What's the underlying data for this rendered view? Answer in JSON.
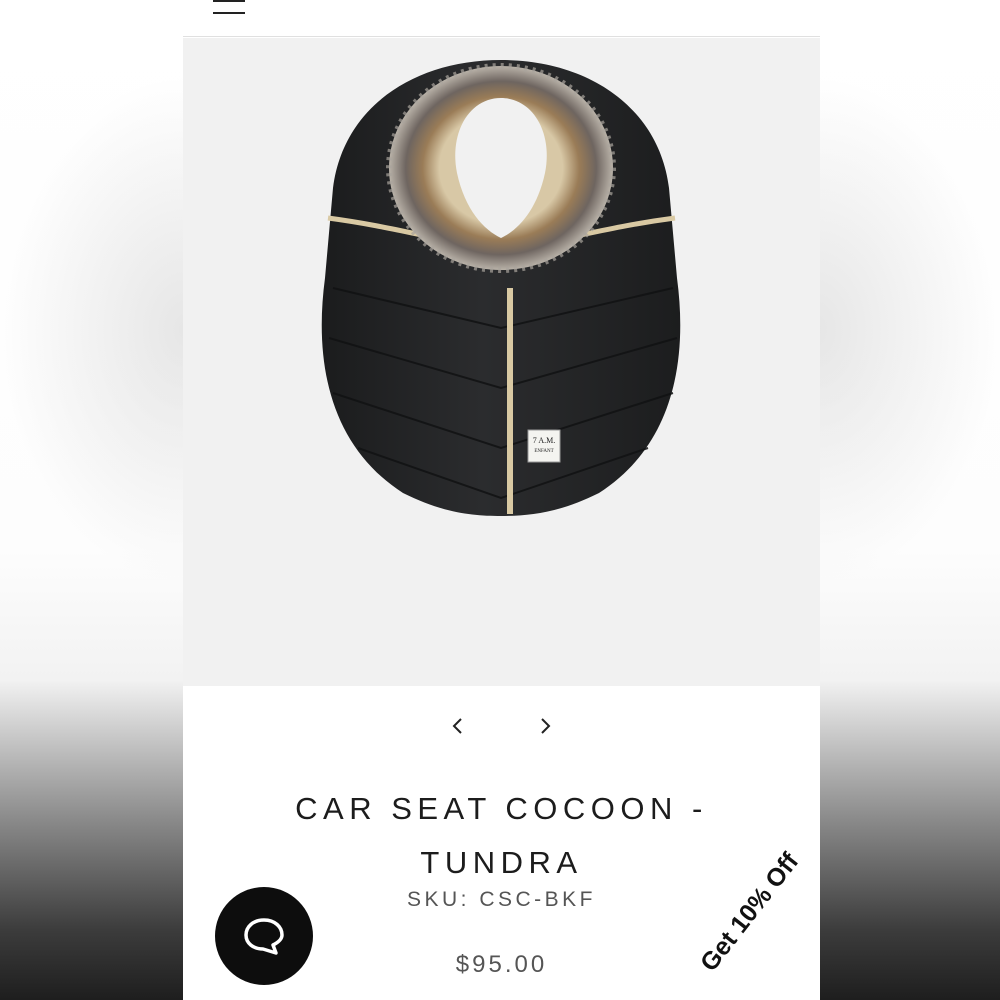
{
  "product": {
    "title": "CAR SEAT COCOON - TUNDRA",
    "sku": "SKU: CSC-BKF",
    "price": "$95.00",
    "image_label": {
      "line1": "7 A.M.",
      "line2": "ENFANT"
    }
  },
  "header": {
    "menu_icon": "hamburger-menu-icon"
  },
  "carousel": {
    "prev_icon": "chevron-left-icon",
    "next_icon": "chevron-right-icon"
  },
  "chat": {
    "icon": "chat-bubble-icon"
  },
  "promo": {
    "label": "Get 10% Off"
  },
  "colors": {
    "hero_bg": "#f1f1f1",
    "cocoon": "#232425",
    "trim": "#d9c9a3",
    "chat_bg": "#0d0d0d"
  }
}
